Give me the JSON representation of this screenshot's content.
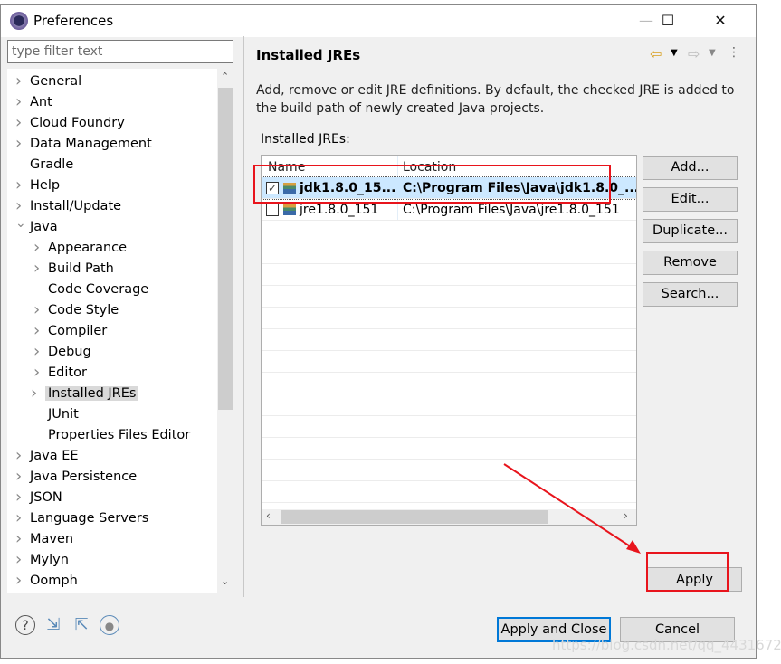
{
  "window": {
    "title": "Preferences",
    "minimize": "—",
    "maximize": "☐",
    "close": "✕"
  },
  "filter": {
    "placeholder": "type filter text",
    "value": ""
  },
  "tree": [
    {
      "label": "General",
      "level": 0,
      "chevron": "right"
    },
    {
      "label": "Ant",
      "level": 0,
      "chevron": "right"
    },
    {
      "label": "Cloud Foundry",
      "level": 0,
      "chevron": "right"
    },
    {
      "label": "Data Management",
      "level": 0,
      "chevron": "right"
    },
    {
      "label": "Gradle",
      "level": 0,
      "chevron": "none"
    },
    {
      "label": "Help",
      "level": 0,
      "chevron": "right"
    },
    {
      "label": "Install/Update",
      "level": 0,
      "chevron": "right"
    },
    {
      "label": "Java",
      "level": 0,
      "chevron": "down"
    },
    {
      "label": "Appearance",
      "level": 1,
      "chevron": "right"
    },
    {
      "label": "Build Path",
      "level": 1,
      "chevron": "right"
    },
    {
      "label": "Code Coverage",
      "level": 1,
      "chevron": "none"
    },
    {
      "label": "Code Style",
      "level": 1,
      "chevron": "right"
    },
    {
      "label": "Compiler",
      "level": 1,
      "chevron": "right"
    },
    {
      "label": "Debug",
      "level": 1,
      "chevron": "right"
    },
    {
      "label": "Editor",
      "level": 1,
      "chevron": "right"
    },
    {
      "label": "Installed JREs",
      "level": 1,
      "chevron": "right",
      "selected": true
    },
    {
      "label": "JUnit",
      "level": 1,
      "chevron": "none"
    },
    {
      "label": "Properties Files Editor",
      "level": 1,
      "chevron": "none"
    },
    {
      "label": "Java EE",
      "level": 0,
      "chevron": "right"
    },
    {
      "label": "Java Persistence",
      "level": 0,
      "chevron": "right"
    },
    {
      "label": "JSON",
      "level": 0,
      "chevron": "right"
    },
    {
      "label": "Language Servers",
      "level": 0,
      "chevron": "right"
    },
    {
      "label": "Maven",
      "level": 0,
      "chevron": "right"
    },
    {
      "label": "Mylyn",
      "level": 0,
      "chevron": "right"
    },
    {
      "label": "Oomph",
      "level": 0,
      "chevron": "right"
    }
  ],
  "page": {
    "title": "Installed JREs",
    "description": "Add, remove or edit JRE definitions. By default, the checked JRE is added to the build path of newly created Java projects.",
    "table_label": "Installed JREs:",
    "columns": [
      "Name",
      "Location"
    ],
    "rows": [
      {
        "name": "jdk1.8.0_15...",
        "location": "C:\\Program Files\\Java\\jdk1.8.0_...",
        "checked": true,
        "bold": true
      },
      {
        "name": "jre1.8.0_151",
        "location": "C:\\Program Files\\Java\\jre1.8.0_151",
        "checked": false,
        "bold": false
      }
    ],
    "buttons": [
      "Add...",
      "Edit...",
      "Duplicate...",
      "Remove",
      "Search..."
    ],
    "apply": "Apply"
  },
  "footer": {
    "apply_close": "Apply and Close",
    "cancel": "Cancel"
  },
  "watermark": "https://blog.csdn.net/qq_44316726",
  "colors": {
    "selection": "#cce8ff",
    "highlight": "#e8141c",
    "focus": "#0078d7"
  }
}
